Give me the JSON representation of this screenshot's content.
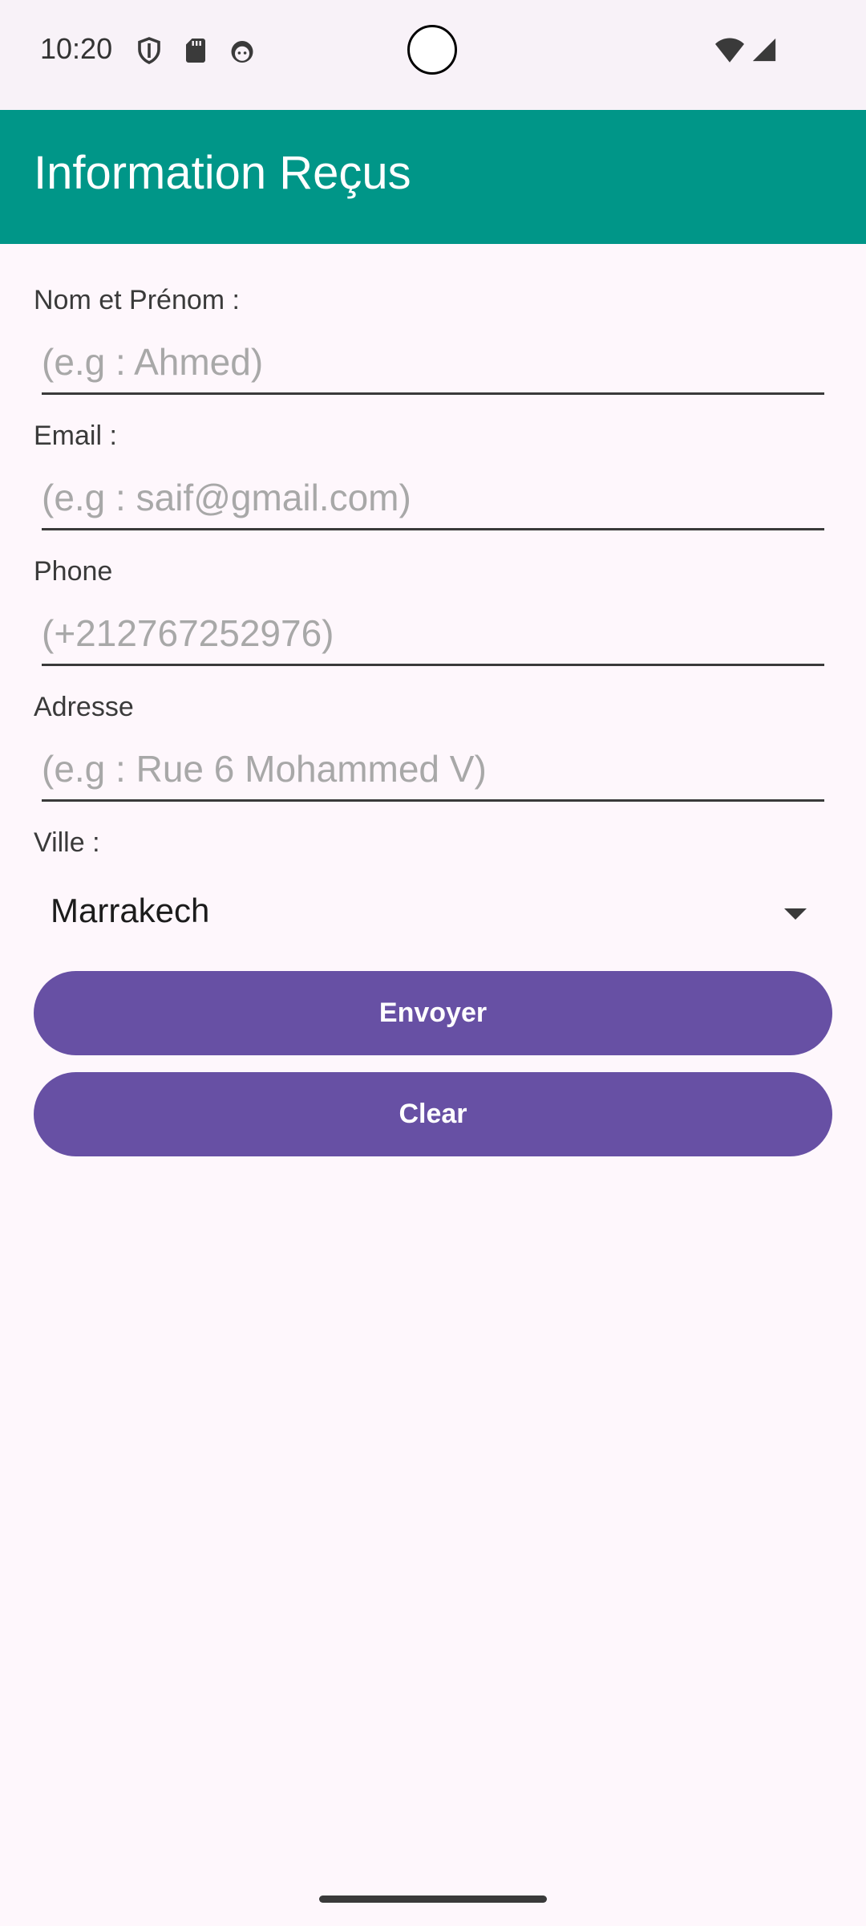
{
  "status_bar": {
    "time": "10:20",
    "icons": [
      "shield-icon",
      "sd-card-icon",
      "android-face-icon",
      "wifi-icon",
      "cellular-signal-icon"
    ]
  },
  "app_bar": {
    "title": "Information Reçus",
    "color": "#009688"
  },
  "form": {
    "name": {
      "label": "Nom et Prénom :",
      "placeholder": "(e.g : Ahmed)",
      "value": ""
    },
    "email": {
      "label": "Email :",
      "placeholder": "(e.g : saif@gmail.com)",
      "value": ""
    },
    "phone": {
      "label": "Phone",
      "placeholder": "(+212767252976)",
      "value": ""
    },
    "address": {
      "label": "Adresse",
      "placeholder": "(e.g : Rue 6 Mohammed V)",
      "value": ""
    },
    "city": {
      "label": "Ville :",
      "selected": "Marrakech"
    }
  },
  "buttons": {
    "send_label": "Envoyer",
    "clear_label": "Clear",
    "color": "#6750A4"
  }
}
